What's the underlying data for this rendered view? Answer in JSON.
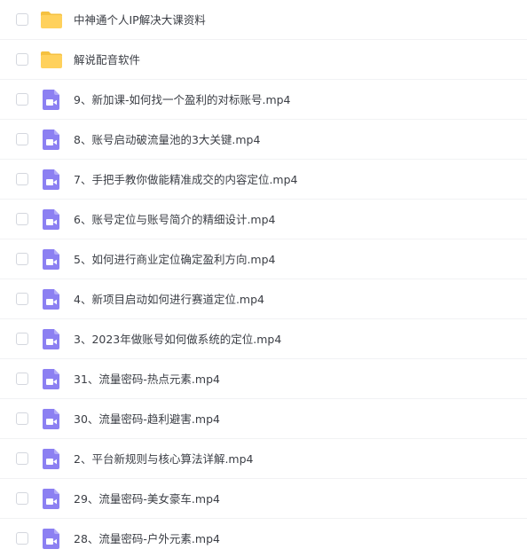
{
  "files": [
    {
      "type": "folder",
      "icon": "folder-icon",
      "name": "中神通个人IP解决大课资料"
    },
    {
      "type": "folder",
      "icon": "folder-icon",
      "name": "解说配音软件"
    },
    {
      "type": "video",
      "icon": "video-file-icon",
      "name": "9、新加课-如何找一个盈利的对标账号.mp4"
    },
    {
      "type": "video",
      "icon": "video-file-icon",
      "name": "8、账号启动破流量池的3大关键.mp4"
    },
    {
      "type": "video",
      "icon": "video-file-icon",
      "name": "7、手把手教你做能精准成交的内容定位.mp4"
    },
    {
      "type": "video",
      "icon": "video-file-icon",
      "name": "6、账号定位与账号简介的精细设计.mp4"
    },
    {
      "type": "video",
      "icon": "video-file-icon",
      "name": "5、如何进行商业定位确定盈利方向.mp4"
    },
    {
      "type": "video",
      "icon": "video-file-icon",
      "name": "4、新项目启动如何进行赛道定位.mp4"
    },
    {
      "type": "video",
      "icon": "video-file-icon",
      "name": "3、2023年做账号如何做系统的定位.mp4"
    },
    {
      "type": "video",
      "icon": "video-file-icon",
      "name": "31、流量密码-热点元素.mp4"
    },
    {
      "type": "video",
      "icon": "video-file-icon",
      "name": "30、流量密码-趋利避害.mp4"
    },
    {
      "type": "video",
      "icon": "video-file-icon",
      "name": "2、平台新规则与核心算法详解.mp4"
    },
    {
      "type": "video",
      "icon": "video-file-icon",
      "name": "29、流量密码-美女豪车.mp4"
    },
    {
      "type": "video",
      "icon": "video-file-icon",
      "name": "28、流量密码-户外元素.mp4"
    }
  ],
  "colors": {
    "folder": "#ffd15c",
    "folder_tab": "#f5c140",
    "video": "#8c80f2",
    "video_fold": "#b3abf7",
    "text": "#3b3e45",
    "checkbox_border": "#d4d7de",
    "divider": "#f1f2f4"
  }
}
